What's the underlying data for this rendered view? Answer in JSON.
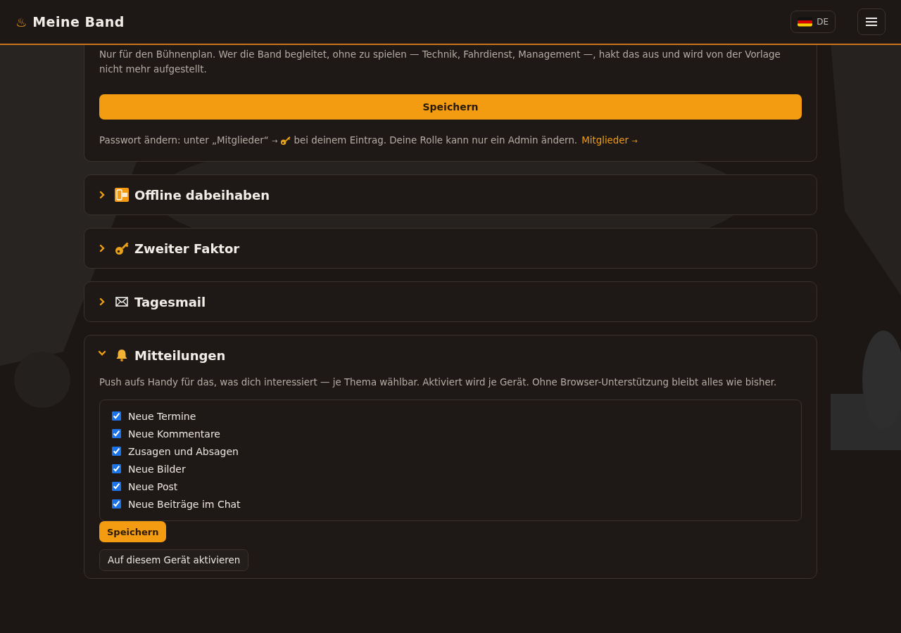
{
  "header": {
    "brand_symbol": "♨",
    "title": "Meine Band",
    "language": "DE"
  },
  "profile_card": {
    "note": "Nur für den Bühnenplan. Wer die Band begleitet, ohne zu spielen — Technik, Fahrdienst, Management —, hakt das aus und wird von der Vorlage nicht mehr aufgestellt.",
    "save_button": "Speichern",
    "password_hint_before": "Passwort ändern: unter „Mitglieder“",
    "password_hint_arrow": "→",
    "password_hint_after": "bei deinem Eintrag. Deine Rolle kann nur ein Admin ändern.",
    "members_link": "Mitglieder",
    "members_link_arrow": "→"
  },
  "sections": [
    {
      "kind": "offline",
      "title": "Offline dabeihaben",
      "expanded": false
    },
    {
      "kind": "key",
      "title": "Zweiter Faktor",
      "expanded": false
    },
    {
      "kind": "mail",
      "title": "Tagesmail",
      "expanded": false
    },
    {
      "kind": "bell",
      "title": "Mitteilungen",
      "expanded": true,
      "description": "Push aufs Handy für das, was dich interessiert — je Thema wählbar. Aktiviert wird je Gerät. Ohne Browser-Unterstützung bleibt alles wie bisher.",
      "topics": [
        {
          "label": "Neue Termine",
          "checked": true
        },
        {
          "label": "Neue Kommentare",
          "checked": true
        },
        {
          "label": "Zusagen und Absagen",
          "checked": true
        },
        {
          "label": "Neue Bilder",
          "checked": true
        },
        {
          "label": "Neue Post",
          "checked": true
        },
        {
          "label": "Neue Beiträge im Chat",
          "checked": true
        }
      ],
      "save_button": "Speichern",
      "activate_button": "Auf diesem Gerät aktivieren"
    }
  ]
}
